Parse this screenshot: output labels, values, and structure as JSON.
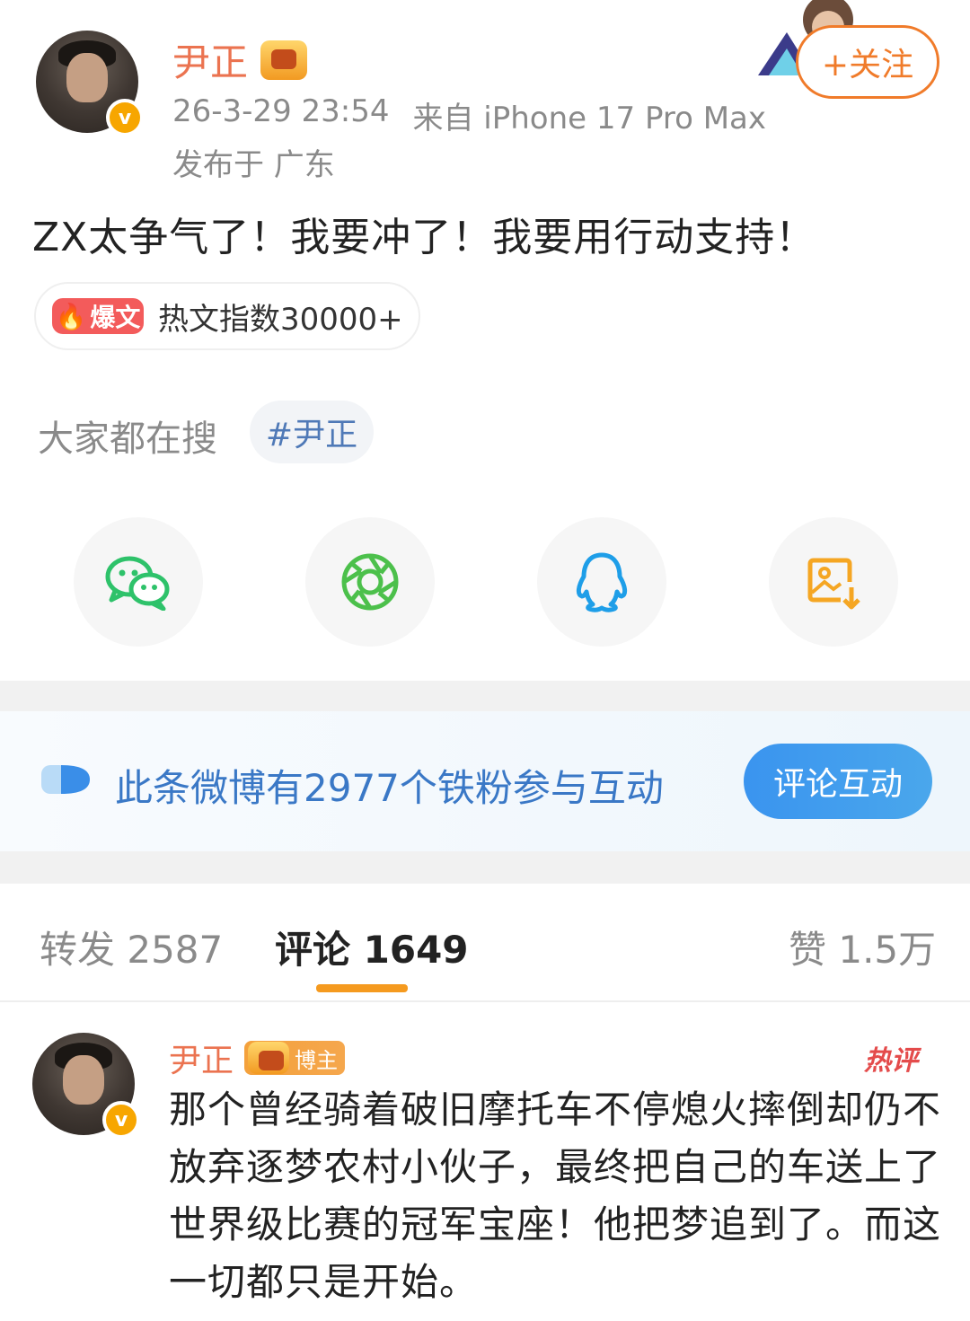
{
  "post": {
    "author": "尹正",
    "timestamp": "26-3-29 23:54",
    "source": "来自 iPhone 17 Pro Max",
    "location": "发布于 广东",
    "follow_label": "+关注",
    "text": "ZX太争气了！我要冲了！我要用行动支持！",
    "hot_tag": "爆文",
    "hot_index": "热文指数30000+"
  },
  "search": {
    "label": "大家都在搜",
    "tag": "#尹正"
  },
  "share": {
    "items": [
      "wechat-icon",
      "moments-icon",
      "qq-icon",
      "save-image-icon"
    ],
    "colors": {
      "wechat": "#2ec26a",
      "moments": "#4cc04b",
      "qq": "#1e9ee8",
      "save": "#f5a623"
    }
  },
  "fans": {
    "text": "此条微博有2977个铁粉参与互动",
    "button": "评论互动"
  },
  "tabs": {
    "repost": "转发 2587",
    "comment": "评论 1649",
    "like": "赞 1.5万"
  },
  "comment": {
    "author": "尹正",
    "badge": "博主",
    "hot_label": "热评",
    "text": "那个曾经骑着破旧摩托车不停熄火摔倒却仍不放弃逐梦农村小伙子，最终把自己的车送上了世界级比赛的冠军宝座！他把梦追到了。而这一切都只是开始。"
  }
}
